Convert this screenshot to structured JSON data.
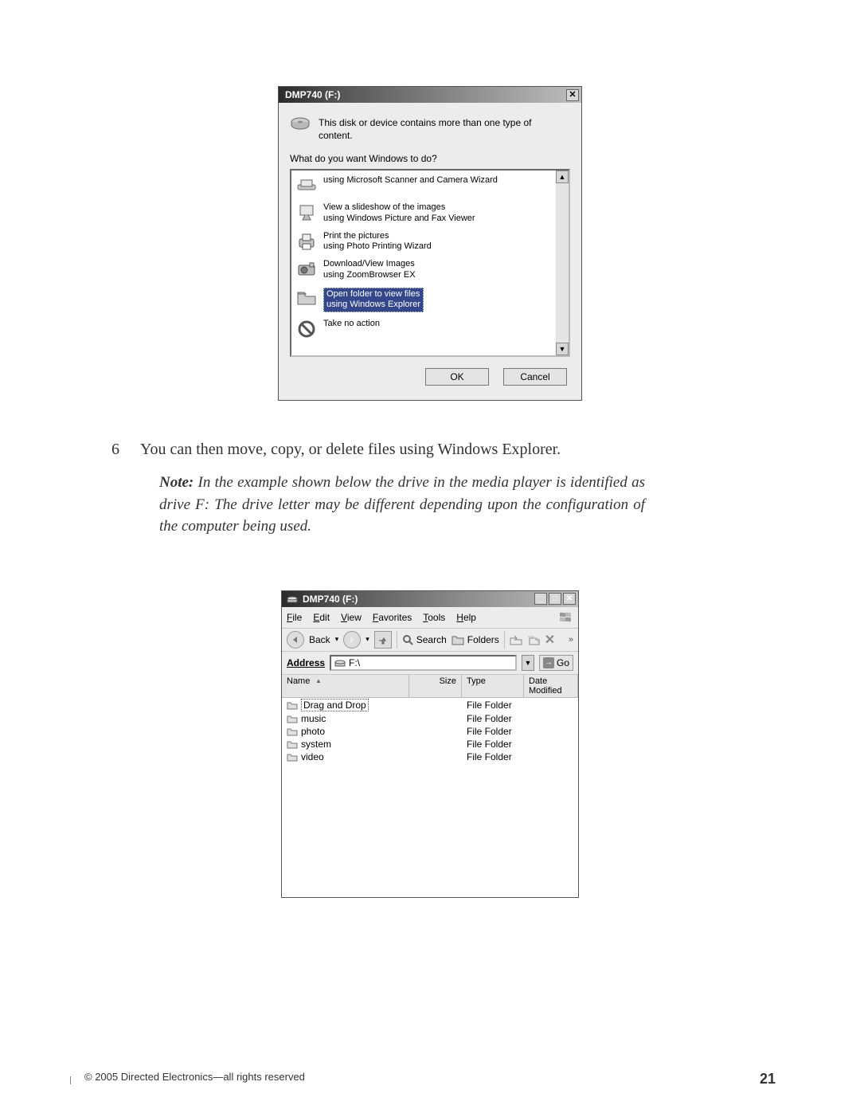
{
  "autoplay": {
    "title": "DMP740 (F:)",
    "close_x": "✕",
    "intro": "This disk or device contains more than one type of content.",
    "question": "What do you want Windows to do?",
    "scroll_up": "▲",
    "scroll_down": "▼",
    "options": [
      {
        "line1": "using Microsoft Scanner and Camera Wizard",
        "line2": ""
      },
      {
        "line1": "View a slideshow of the images",
        "line2": "using Windows Picture and Fax Viewer"
      },
      {
        "line1": "Print the pictures",
        "line2": "using Photo Printing Wizard"
      },
      {
        "line1": "Download/View Images",
        "line2": "using ZoomBrowser EX"
      },
      {
        "line1": "Open folder to view files",
        "line2": "using Windows Explorer"
      },
      {
        "line1": "Take no action",
        "line2": ""
      }
    ],
    "ok": "OK",
    "cancel": "Cancel"
  },
  "step": {
    "num": "6",
    "text": "You can then move, copy, or delete files using Windows Explorer."
  },
  "note": {
    "label": "Note:",
    "text": "In the example shown below the drive in the media player is identified as drive F: The drive letter may be different depending upon the configuration of the computer being used."
  },
  "explorer": {
    "title": "DMP740 (F:)",
    "win_min": "_",
    "win_max": "□",
    "win_close": "✕",
    "menu": [
      "File",
      "Edit",
      "View",
      "Favorites",
      "Tools",
      "Help"
    ],
    "back": "Back",
    "back_chevron": "▾",
    "forward_chevron": "▾",
    "search": "Search",
    "folders": "Folders",
    "more": "»",
    "address_label_pre": "A",
    "address_label_u": "d",
    "address_label_post": "dress",
    "address_value": "F:\\",
    "go": "Go",
    "headers": {
      "name": "Name",
      "size": "Size",
      "type": "Type",
      "date": "Date Modified"
    },
    "sort_glyph": "▲",
    "rows": [
      {
        "name": "Drag and Drop",
        "type": "File Folder",
        "dotted": true
      },
      {
        "name": "music",
        "type": "File Folder"
      },
      {
        "name": "photo",
        "type": "File Folder"
      },
      {
        "name": "system",
        "type": "File Folder"
      },
      {
        "name": "video",
        "type": "File Folder"
      }
    ]
  },
  "footer": {
    "copy": "© 2005  Directed Electronics—all rights reserved",
    "page": "21"
  }
}
